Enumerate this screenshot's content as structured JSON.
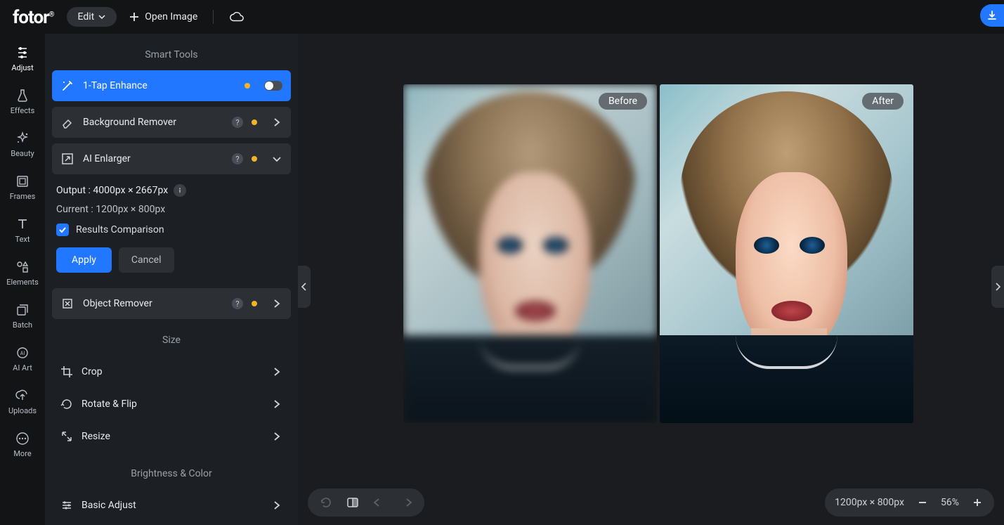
{
  "brand": "fotor",
  "topbar": {
    "edit_label": "Edit",
    "open_image_label": "Open Image"
  },
  "rail": [
    {
      "key": "adjust",
      "label": "Adjust"
    },
    {
      "key": "effects",
      "label": "Effects"
    },
    {
      "key": "beauty",
      "label": "Beauty"
    },
    {
      "key": "frames",
      "label": "Frames"
    },
    {
      "key": "text",
      "label": "Text"
    },
    {
      "key": "elements",
      "label": "Elements"
    },
    {
      "key": "batch",
      "label": "Batch"
    },
    {
      "key": "aiart",
      "label": "AI Art"
    },
    {
      "key": "uploads",
      "label": "Uploads"
    },
    {
      "key": "more",
      "label": "More"
    }
  ],
  "panel": {
    "smart_tools_title": "Smart Tools",
    "one_tap_enhance": "1-Tap Enhance",
    "background_remover": "Background Remover",
    "ai_enlarger": "AI Enlarger",
    "enlarger": {
      "output_label": "Output : 4000px × 2667px",
      "current_label": "Current : 1200px × 800px",
      "results_comparison_label": "Results Comparison",
      "apply_label": "Apply",
      "cancel_label": "Cancel"
    },
    "object_remover": "Object Remover",
    "size_title": "Size",
    "crop": "Crop",
    "rotate_flip": "Rotate & Flip",
    "resize": "Resize",
    "brightness_color_title": "Brightness & Color",
    "basic_adjust": "Basic Adjust"
  },
  "canvas": {
    "before_label": "Before",
    "after_label": "After"
  },
  "zoombar": {
    "dimensions": "1200px × 800px",
    "zoom_pct": "56%"
  }
}
